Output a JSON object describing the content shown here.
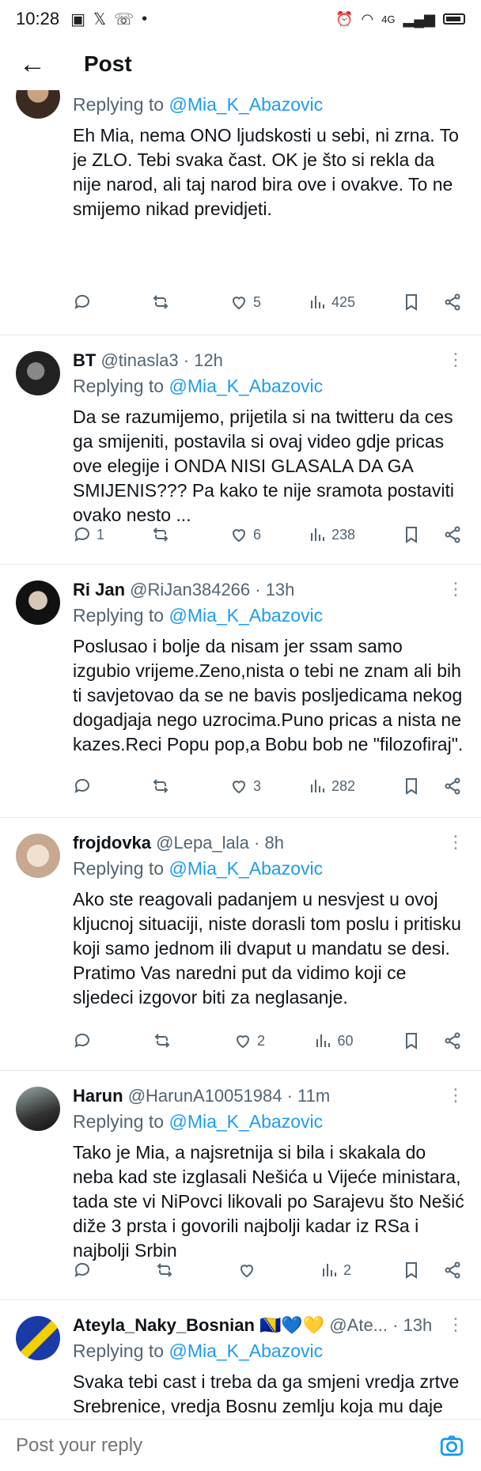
{
  "status_bar": {
    "time": "10:28",
    "network": "4G"
  },
  "header": {
    "title": "Post"
  },
  "reply_prefix": "Replying to",
  "tweets": [
    {
      "name": "",
      "handle": "",
      "time": "",
      "replying_to": "@Mia_K_Abazovic",
      "text": "Eh Mia, nema ONO ljudskosti u sebi, ni zrna. To je ZLO. Tebi svaka čast. OK je što si rekla da nije narod, ali taj narod bira ove i ovakve. To ne smijemo nikad previdjeti.",
      "replies": "",
      "reposts": "",
      "likes": "5",
      "views": "425"
    },
    {
      "name": "BT",
      "handle": "@tinasla3 · 12h",
      "replying_to": "@Mia_K_Abazovic",
      "text": "Da se razumijemo, prijetila si  na twitteru da ces ga smijeniti, postavila si ovaj video gdje pricas ove elegije  i ONDA NISI GLASALA DA GA SMIJENIS??? Pa kako te nije sramota postaviti ovako nesto ...",
      "replies": "1",
      "reposts": "",
      "likes": "6",
      "views": "238"
    },
    {
      "name": "Ri Jan",
      "handle": "@RiJan384266 · 13h",
      "replying_to": "@Mia_K_Abazovic",
      "text": "Poslusao i bolje da nisam jer ssam samo izgubio vrijeme.Zeno,nista o tebi ne znam ali bih ti savjetovao da se ne bavis posljedicama nekog dogadjaja nego uzrocima.Puno pricas a nista ne kazes.Reci Popu pop,a Bobu bob ne \"filozofiraj\".",
      "replies": "",
      "reposts": "",
      "likes": "3",
      "views": "282"
    },
    {
      "name": "frojdovka",
      "handle": "@Lepa_lala · 8h",
      "replying_to": "@Mia_K_Abazovic",
      "text": "Ako ste reagovali padanjem u nesvjest u ovoj kljucnoj situaciji, niste dorasli tom poslu i pritisku koji samo jednom ili dvaput u mandatu se desi. Pratimo Vas naredni put da vidimo koji ce sljedeci izgovor biti za neglasanje.",
      "replies": "",
      "reposts": "",
      "likes": "2",
      "views": "60"
    },
    {
      "name": "Harun",
      "handle": "@HarunA10051984 · 11m",
      "replying_to": "@Mia_K_Abazovic",
      "text": "Tako je Mia, a najsretnija si bila i skakala do neba kad ste izglasali Nešića u Vijeće ministara, tada ste vi NiPovci likovali po Sarajevu što Nešić diže 3 prsta i govorili najbolji kadar iz RSa i najbolji Srbin",
      "replies": "",
      "reposts": "",
      "likes": "",
      "views": "2"
    },
    {
      "name": "Ateyla_Naky_Bosnian",
      "name_emoji": "🇧🇦💙💛",
      "handle": "@Ate... · 13h",
      "replying_to": "@Mia_K_Abazovic",
      "text": "Svaka tebi cast i treba da ga smjeni  vredja zrtve Srebrenice, vredja Bosnu zemlju koja mu daje kruh vredja Hrvatsku .Bosna mora da bude pravna država i svi u Bosni zelimo i EU i NATO .",
      "replies": "",
      "reposts": "",
      "likes": "",
      "views": ""
    }
  ],
  "reply_bar": {
    "placeholder": "Post your reply"
  },
  "colors": {
    "accent": "#1d9bf0",
    "text": "#0f1419",
    "muted": "#536471",
    "divider": "#e6e9eb"
  },
  "icons": [
    "back-arrow-icon",
    "reply-icon",
    "repost-icon",
    "like-icon",
    "views-icon",
    "bookmark-icon",
    "share-icon",
    "camera-icon",
    "more-icon"
  ]
}
